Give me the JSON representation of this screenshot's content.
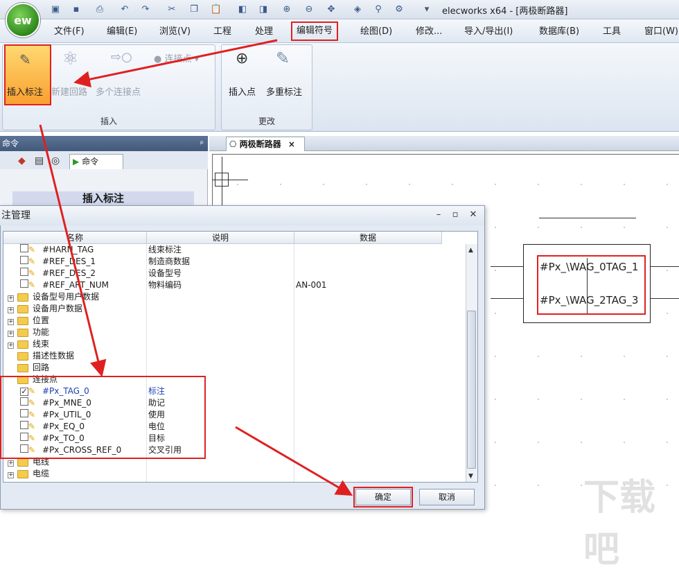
{
  "window": {
    "title": "elecworks x64 - [两极断路器]",
    "logo": "ew"
  },
  "menu": [
    "文件(F)",
    "编辑(E)",
    "浏览(V)",
    "工程",
    "处理",
    "编辑符号",
    "绘图(D)",
    "修改...",
    "导入/导出(I)",
    "数据库(B)",
    "工具",
    "窗口(W)"
  ],
  "ribbon": {
    "insert_group": {
      "label": "插入",
      "insert_tag": "插入标注",
      "new_circuit": "新建回路",
      "multi_conn": "多个连接点",
      "conn_point": "连接点"
    },
    "modify_group": {
      "label": "更改",
      "insert_point": "插入点",
      "multi_tag": "多重标注"
    }
  },
  "left_panel": {
    "header": "命令",
    "pin": "ᵖ",
    "tab": "命令",
    "heading": "插入标注"
  },
  "document": {
    "tab": "两极断路器",
    "close": "×"
  },
  "drawing": {
    "tag1": "#Px_TAG_0  #Px_TAG_1",
    "tag1_display": "#Px_\\WAG_0TAG_1",
    "tag2_display": "#Px_\\WAG_2TAG_3"
  },
  "dialog": {
    "title": "注管理",
    "columns": [
      "名称",
      "说明",
      "数据"
    ],
    "rows": [
      {
        "type": "item",
        "checked": false,
        "name": "#HARN_TAG",
        "desc": "线束标注",
        "data": ""
      },
      {
        "type": "item",
        "checked": false,
        "name": "#REF_DES_1",
        "desc": "制造商数据",
        "data": ""
      },
      {
        "type": "item",
        "checked": false,
        "name": "#REF_DES_2",
        "desc": "设备型号",
        "data": ""
      },
      {
        "type": "item",
        "checked": false,
        "name": "#REF_ART_NUM",
        "desc": "物料编码",
        "data": "AN-001"
      },
      {
        "type": "folder",
        "expand": "+",
        "name": "设备型号用户数据"
      },
      {
        "type": "folder",
        "expand": "+",
        "name": "设备用户数据"
      },
      {
        "type": "folder",
        "expand": "+",
        "name": "位置"
      },
      {
        "type": "folder",
        "expand": "+",
        "name": "功能"
      },
      {
        "type": "folder",
        "expand": "+",
        "name": "线束"
      },
      {
        "type": "folder",
        "expand": "",
        "name": "描述性数据"
      },
      {
        "type": "folder",
        "expand": "",
        "name": "回路"
      },
      {
        "type": "folder",
        "expand": "",
        "name": "连接点"
      },
      {
        "type": "item",
        "checked": true,
        "name": "#Px_TAG_0",
        "desc": "标注",
        "data": "",
        "color": "#1a3fb0"
      },
      {
        "type": "item",
        "checked": false,
        "name": "#Px_MNE_0",
        "desc": "助记",
        "data": ""
      },
      {
        "type": "item",
        "checked": false,
        "name": "#Px_UTIL_0",
        "desc": "使用",
        "data": ""
      },
      {
        "type": "item",
        "checked": false,
        "name": "#Px_EQ_0",
        "desc": "电位",
        "data": ""
      },
      {
        "type": "item",
        "checked": false,
        "name": "#Px_TO_0",
        "desc": "目标",
        "data": ""
      },
      {
        "type": "item",
        "checked": false,
        "name": "#Px_CROSS_REF_0",
        "desc": "交叉引用",
        "data": ""
      },
      {
        "type": "folder",
        "expand": "+",
        "name": "电线"
      },
      {
        "type": "folder",
        "expand": "+",
        "name": "电缆"
      }
    ],
    "ok": "确定",
    "cancel": "取消"
  },
  "watermark": "下载吧",
  "colors": {
    "highlight": "#e02020",
    "selected_text": "#1a3fb0"
  }
}
